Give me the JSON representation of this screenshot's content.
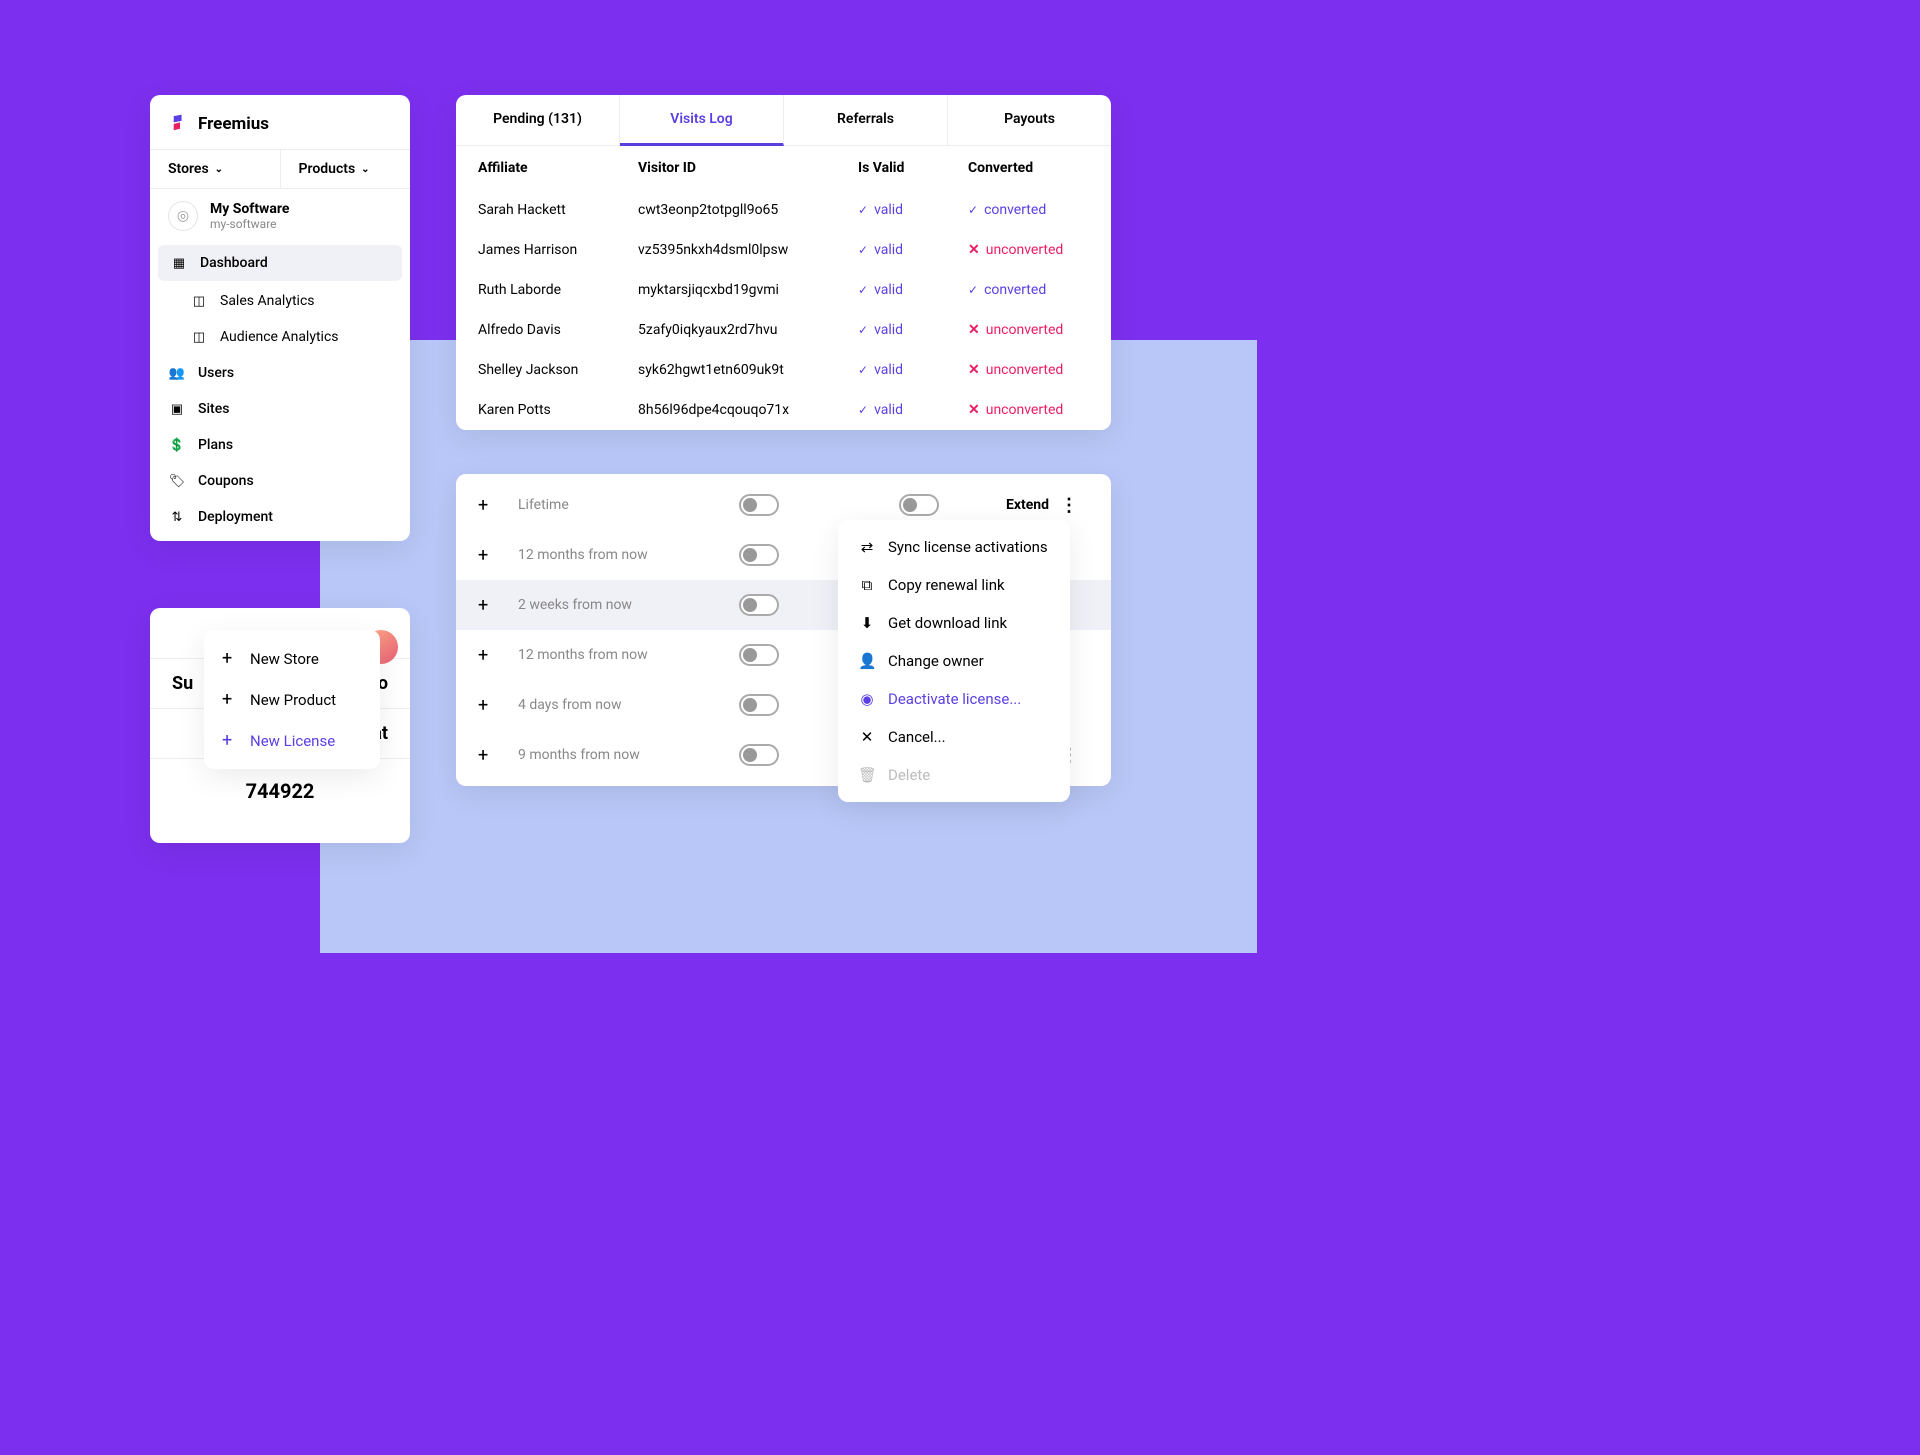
{
  "brand": "Freemius",
  "topnav": {
    "stores": "Stores",
    "products": "Products"
  },
  "product": {
    "name": "My Software",
    "slug": "my-software"
  },
  "sidebar": {
    "items": [
      {
        "label": "Dashboard",
        "icon": "▦",
        "active": true
      },
      {
        "label": "Sales Analytics",
        "icon": "◫",
        "sub": true
      },
      {
        "label": "Audience Analytics",
        "icon": "◫",
        "sub": true
      },
      {
        "label": "Users",
        "icon": "👥"
      },
      {
        "label": "Sites",
        "icon": "▣"
      },
      {
        "label": "Plans",
        "icon": "💲"
      },
      {
        "label": "Coupons",
        "icon": "🏷"
      },
      {
        "label": "Deployment",
        "icon": "⇅"
      }
    ]
  },
  "table": {
    "tabs": [
      {
        "label": "Pending (131)"
      },
      {
        "label": "Visits Log",
        "active": true
      },
      {
        "label": "Referrals"
      },
      {
        "label": "Payouts"
      }
    ],
    "headers": [
      "Affiliate",
      "Visitor ID",
      "Is Valid",
      "Converted"
    ],
    "rows": [
      {
        "affiliate": "Sarah Hackett",
        "visitor": "cwt3eonp2totpgll9o65",
        "valid": "valid",
        "converted": "converted"
      },
      {
        "affiliate": "James Harrison",
        "visitor": "vz5395nkxh4dsml0lpsw",
        "valid": "valid",
        "converted": "unconverted"
      },
      {
        "affiliate": "Ruth Laborde",
        "visitor": "myktarsjiqcxbd19gvmi",
        "valid": "valid",
        "converted": "converted"
      },
      {
        "affiliate": "Alfredo Davis",
        "visitor": "5zafy0iqkyaux2rd7hvu",
        "valid": "valid",
        "converted": "unconverted"
      },
      {
        "affiliate": "Shelley Jackson",
        "visitor": "syk62hgwt1etn609uk9t",
        "valid": "valid",
        "converted": "unconverted"
      },
      {
        "affiliate": "Karen Potts",
        "visitor": "8h56l96dpe4cqouqo71x",
        "valid": "valid",
        "converted": "unconverted"
      }
    ]
  },
  "licenses": {
    "extend_label": "Extend",
    "rows": [
      {
        "label": "Lifetime"
      },
      {
        "label": "12 months from now"
      },
      {
        "label": "2 weeks from now",
        "hl": true
      },
      {
        "label": "12 months from now"
      },
      {
        "label": "4 days from now"
      },
      {
        "label": "9 months from now"
      }
    ]
  },
  "dropdown": {
    "items": [
      {
        "label": "Sync license activations",
        "icon": "⇄"
      },
      {
        "label": "Copy renewal link",
        "icon": "⧉"
      },
      {
        "label": "Get download link",
        "icon": "⬇"
      },
      {
        "label": "Change owner",
        "icon": "👤"
      },
      {
        "label": "Deactivate license...",
        "icon": "◉",
        "accent": true
      },
      {
        "label": "Cancel...",
        "icon": "✕"
      },
      {
        "label": "Delete",
        "icon": "🗑",
        "disabled": true
      }
    ]
  },
  "popup": {
    "items": [
      {
        "label": "New Store"
      },
      {
        "label": "New Product"
      },
      {
        "label": "New License",
        "accent": true
      }
    ]
  },
  "bottom": {
    "row1a": "Su",
    "row1b": "Downlo",
    "row2a": "",
    "row2b": "Activat",
    "bignum": "744922"
  }
}
